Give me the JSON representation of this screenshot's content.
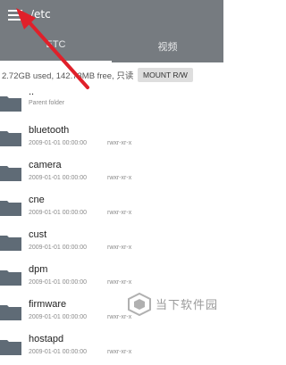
{
  "header": {
    "path": "/etc",
    "tabs": [
      {
        "label": "ETC"
      },
      {
        "label": "视频"
      }
    ]
  },
  "storage": {
    "info": "2.72GB used, 142.73MB free, 只读",
    "mount_button": "MOUNT R/W"
  },
  "files": [
    {
      "name": "..",
      "detail": "Parent folder",
      "perm": ""
    },
    {
      "name": "bluetooth",
      "detail": "2009-01-01 00:00:00",
      "perm": "rwxr-xr-x"
    },
    {
      "name": "camera",
      "detail": "2009-01-01 00:00:00",
      "perm": "rwxr-xr-x"
    },
    {
      "name": "cne",
      "detail": "2009-01-01 00:00:00",
      "perm": "rwxr-xr-x"
    },
    {
      "name": "cust",
      "detail": "2009-01-01 00:00:00",
      "perm": "rwxr-xr-x"
    },
    {
      "name": "dpm",
      "detail": "2009-01-01 00:00:00",
      "perm": "rwxr-xr-x"
    },
    {
      "name": "firmware",
      "detail": "2009-01-01 00:00:00",
      "perm": "rwxr-xr-x"
    },
    {
      "name": "hostapd",
      "detail": "2009-01-01 00:00:00",
      "perm": "rwxr-xr-x"
    }
  ],
  "watermark": {
    "text": "当下软件园"
  },
  "colors": {
    "appbar": "#767b80",
    "folder": "#5f6b76",
    "arrow": "#e0202a"
  }
}
